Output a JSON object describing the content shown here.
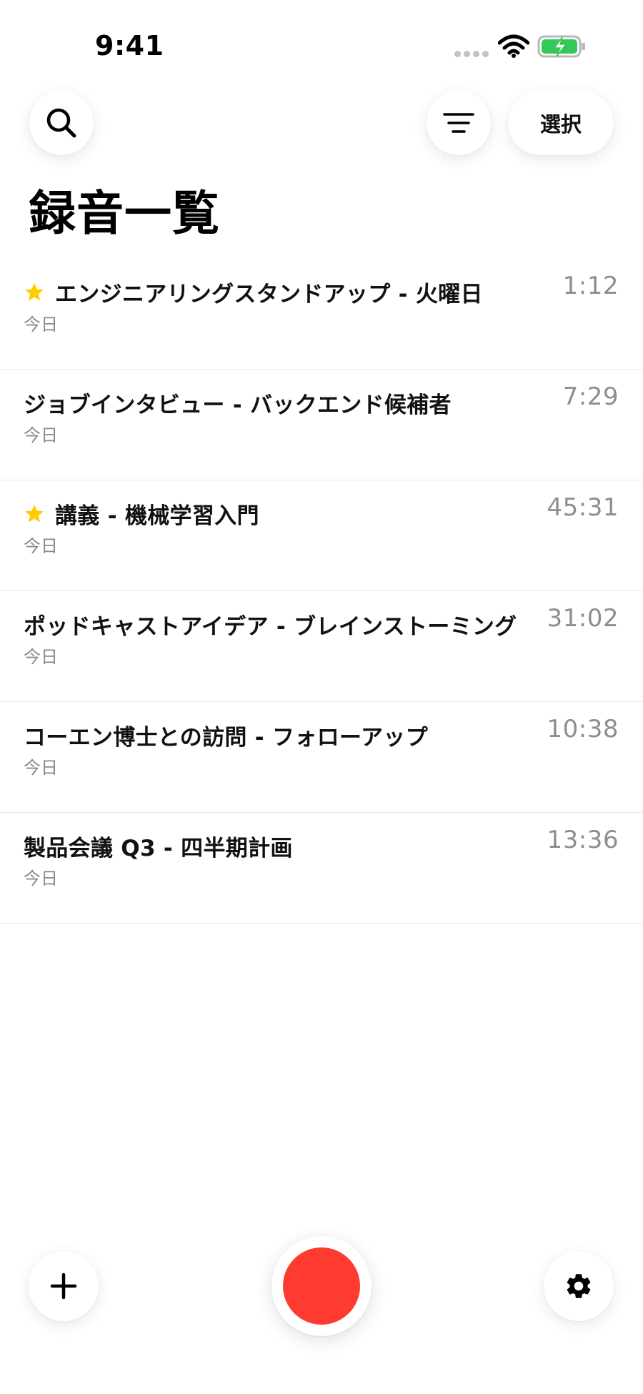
{
  "status_bar": {
    "time": "9:41",
    "icons": [
      "signal-dots-icon",
      "wifi-icon",
      "battery-charging-icon"
    ],
    "battery_color": "#34c759"
  },
  "header": {
    "search_icon": "search-icon",
    "filter_icon": "filter-icon",
    "select_label": "選択",
    "title": "録音一覧"
  },
  "recordings": [
    {
      "starred": true,
      "title": "エンジニアリングスタンドアップ - 火曜日",
      "date": "今日",
      "duration": "1:12"
    },
    {
      "starred": false,
      "title": "ジョブインタビュー - バックエンド候補者",
      "date": "今日",
      "duration": "7:29"
    },
    {
      "starred": true,
      "title": "講義 - 機械学習入門",
      "date": "今日",
      "duration": "45:31"
    },
    {
      "starred": false,
      "title": "ポッドキャストアイデア - ブレインストーミング",
      "date": "今日",
      "duration": "31:02"
    },
    {
      "starred": false,
      "title": "コーエン博士との訪問 - フォローアップ",
      "date": "今日",
      "duration": "10:38"
    },
    {
      "starred": false,
      "title": "製品会議 Q3 - 四半期計画",
      "date": "今日",
      "duration": "13:36"
    }
  ],
  "bottom_bar": {
    "add_icon": "plus-icon",
    "record_icon": "record-icon",
    "settings_icon": "gear-icon",
    "record_color": "#ff3b30",
    "star_color": "#ffcc00"
  }
}
